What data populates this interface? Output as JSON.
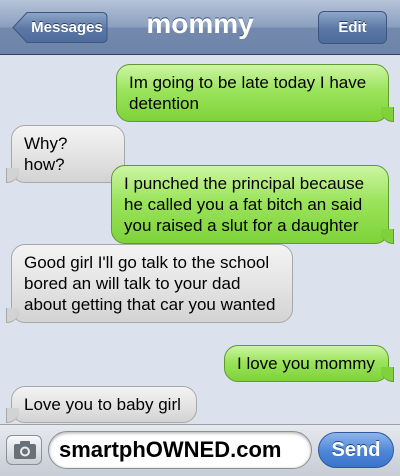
{
  "nav": {
    "back_label": "Messages",
    "title": "mommy",
    "edit_label": "Edit"
  },
  "messages": [
    {
      "side": "sent",
      "text": "Im going to be late today I have detention"
    },
    {
      "side": "received",
      "text": "Why? how?"
    },
    {
      "side": "sent",
      "text": "I punched the principal because he called you a fat bitch an said you raised a slut for a daughter"
    },
    {
      "side": "received",
      "text": "Good girl I'll go talk to the school bored an will talk to your dad about getting that car you wanted"
    },
    {
      "side": "sent",
      "text": "I love you mommy"
    },
    {
      "side": "received",
      "text": "Love you to baby girl"
    }
  ],
  "compose": {
    "value": "smartphOWNED.com",
    "send_label": "Send"
  },
  "colors": {
    "sent_bubble": "#9be45c",
    "received_bubble": "#e3e3e3",
    "nav_bar": "#7389ad",
    "send_button": "#4d86d8"
  },
  "icons": {
    "back": "chevron-left-icon",
    "camera": "camera-icon"
  }
}
